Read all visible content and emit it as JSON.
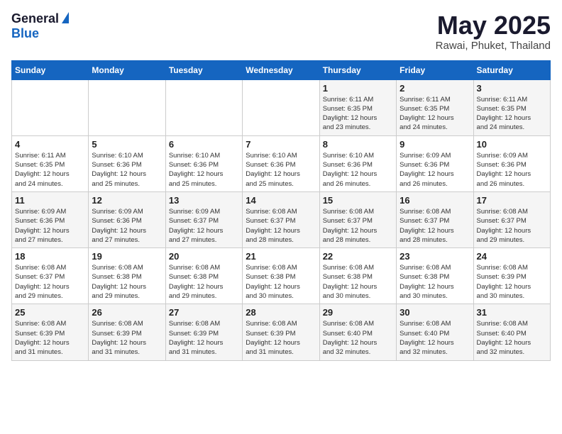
{
  "header": {
    "logo_general": "General",
    "logo_blue": "Blue",
    "title_month": "May 2025",
    "title_location": "Rawai, Phuket, Thailand"
  },
  "days_of_week": [
    "Sunday",
    "Monday",
    "Tuesday",
    "Wednesday",
    "Thursday",
    "Friday",
    "Saturday"
  ],
  "weeks": [
    [
      {
        "day": "",
        "info": ""
      },
      {
        "day": "",
        "info": ""
      },
      {
        "day": "",
        "info": ""
      },
      {
        "day": "",
        "info": ""
      },
      {
        "day": "1",
        "info": "Sunrise: 6:11 AM\nSunset: 6:35 PM\nDaylight: 12 hours\nand 23 minutes."
      },
      {
        "day": "2",
        "info": "Sunrise: 6:11 AM\nSunset: 6:35 PM\nDaylight: 12 hours\nand 24 minutes."
      },
      {
        "day": "3",
        "info": "Sunrise: 6:11 AM\nSunset: 6:35 PM\nDaylight: 12 hours\nand 24 minutes."
      }
    ],
    [
      {
        "day": "4",
        "info": "Sunrise: 6:11 AM\nSunset: 6:35 PM\nDaylight: 12 hours\nand 24 minutes."
      },
      {
        "day": "5",
        "info": "Sunrise: 6:10 AM\nSunset: 6:36 PM\nDaylight: 12 hours\nand 25 minutes."
      },
      {
        "day": "6",
        "info": "Sunrise: 6:10 AM\nSunset: 6:36 PM\nDaylight: 12 hours\nand 25 minutes."
      },
      {
        "day": "7",
        "info": "Sunrise: 6:10 AM\nSunset: 6:36 PM\nDaylight: 12 hours\nand 25 minutes."
      },
      {
        "day": "8",
        "info": "Sunrise: 6:10 AM\nSunset: 6:36 PM\nDaylight: 12 hours\nand 26 minutes."
      },
      {
        "day": "9",
        "info": "Sunrise: 6:09 AM\nSunset: 6:36 PM\nDaylight: 12 hours\nand 26 minutes."
      },
      {
        "day": "10",
        "info": "Sunrise: 6:09 AM\nSunset: 6:36 PM\nDaylight: 12 hours\nand 26 minutes."
      }
    ],
    [
      {
        "day": "11",
        "info": "Sunrise: 6:09 AM\nSunset: 6:36 PM\nDaylight: 12 hours\nand 27 minutes."
      },
      {
        "day": "12",
        "info": "Sunrise: 6:09 AM\nSunset: 6:36 PM\nDaylight: 12 hours\nand 27 minutes."
      },
      {
        "day": "13",
        "info": "Sunrise: 6:09 AM\nSunset: 6:37 PM\nDaylight: 12 hours\nand 27 minutes."
      },
      {
        "day": "14",
        "info": "Sunrise: 6:08 AM\nSunset: 6:37 PM\nDaylight: 12 hours\nand 28 minutes."
      },
      {
        "day": "15",
        "info": "Sunrise: 6:08 AM\nSunset: 6:37 PM\nDaylight: 12 hours\nand 28 minutes."
      },
      {
        "day": "16",
        "info": "Sunrise: 6:08 AM\nSunset: 6:37 PM\nDaylight: 12 hours\nand 28 minutes."
      },
      {
        "day": "17",
        "info": "Sunrise: 6:08 AM\nSunset: 6:37 PM\nDaylight: 12 hours\nand 29 minutes."
      }
    ],
    [
      {
        "day": "18",
        "info": "Sunrise: 6:08 AM\nSunset: 6:37 PM\nDaylight: 12 hours\nand 29 minutes."
      },
      {
        "day": "19",
        "info": "Sunrise: 6:08 AM\nSunset: 6:38 PM\nDaylight: 12 hours\nand 29 minutes."
      },
      {
        "day": "20",
        "info": "Sunrise: 6:08 AM\nSunset: 6:38 PM\nDaylight: 12 hours\nand 29 minutes."
      },
      {
        "day": "21",
        "info": "Sunrise: 6:08 AM\nSunset: 6:38 PM\nDaylight: 12 hours\nand 30 minutes."
      },
      {
        "day": "22",
        "info": "Sunrise: 6:08 AM\nSunset: 6:38 PM\nDaylight: 12 hours\nand 30 minutes."
      },
      {
        "day": "23",
        "info": "Sunrise: 6:08 AM\nSunset: 6:38 PM\nDaylight: 12 hours\nand 30 minutes."
      },
      {
        "day": "24",
        "info": "Sunrise: 6:08 AM\nSunset: 6:39 PM\nDaylight: 12 hours\nand 30 minutes."
      }
    ],
    [
      {
        "day": "25",
        "info": "Sunrise: 6:08 AM\nSunset: 6:39 PM\nDaylight: 12 hours\nand 31 minutes."
      },
      {
        "day": "26",
        "info": "Sunrise: 6:08 AM\nSunset: 6:39 PM\nDaylight: 12 hours\nand 31 minutes."
      },
      {
        "day": "27",
        "info": "Sunrise: 6:08 AM\nSunset: 6:39 PM\nDaylight: 12 hours\nand 31 minutes."
      },
      {
        "day": "28",
        "info": "Sunrise: 6:08 AM\nSunset: 6:39 PM\nDaylight: 12 hours\nand 31 minutes."
      },
      {
        "day": "29",
        "info": "Sunrise: 6:08 AM\nSunset: 6:40 PM\nDaylight: 12 hours\nand 32 minutes."
      },
      {
        "day": "30",
        "info": "Sunrise: 6:08 AM\nSunset: 6:40 PM\nDaylight: 12 hours\nand 32 minutes."
      },
      {
        "day": "31",
        "info": "Sunrise: 6:08 AM\nSunset: 6:40 PM\nDaylight: 12 hours\nand 32 minutes."
      }
    ]
  ]
}
